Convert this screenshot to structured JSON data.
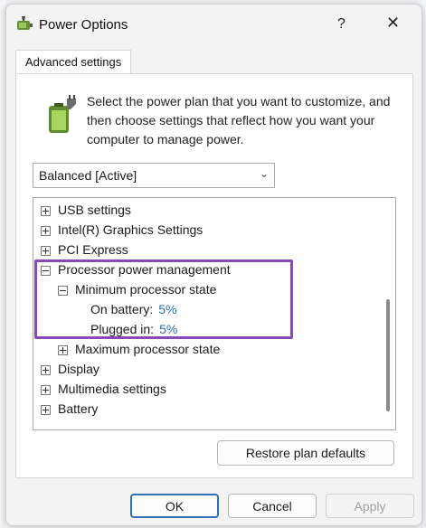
{
  "window": {
    "title": "Power Options",
    "help_label": "?",
    "close_label": "✕"
  },
  "tab": {
    "label": "Advanced settings"
  },
  "description": "Select the power plan that you want to customize, and then choose settings that reflect how you want your computer to manage power.",
  "plan_select": {
    "value": "Balanced [Active]"
  },
  "tree": {
    "usb": "USB settings",
    "graphics": "Intel(R) Graphics Settings",
    "pci": "PCI Express",
    "processor": "Processor power management",
    "min_state": "Minimum processor state",
    "on_battery_label": "On battery:",
    "on_battery_value": "5%",
    "plugged_label": "Plugged in:",
    "plugged_value": "5%",
    "max_state": "Maximum processor state",
    "display": "Display",
    "multimedia": "Multimedia settings",
    "battery": "Battery"
  },
  "buttons": {
    "restore": "Restore plan defaults",
    "ok": "OK",
    "cancel": "Cancel",
    "apply": "Apply"
  },
  "colors": {
    "highlight": "#8a48b8",
    "value_link": "#2a6fb5"
  }
}
